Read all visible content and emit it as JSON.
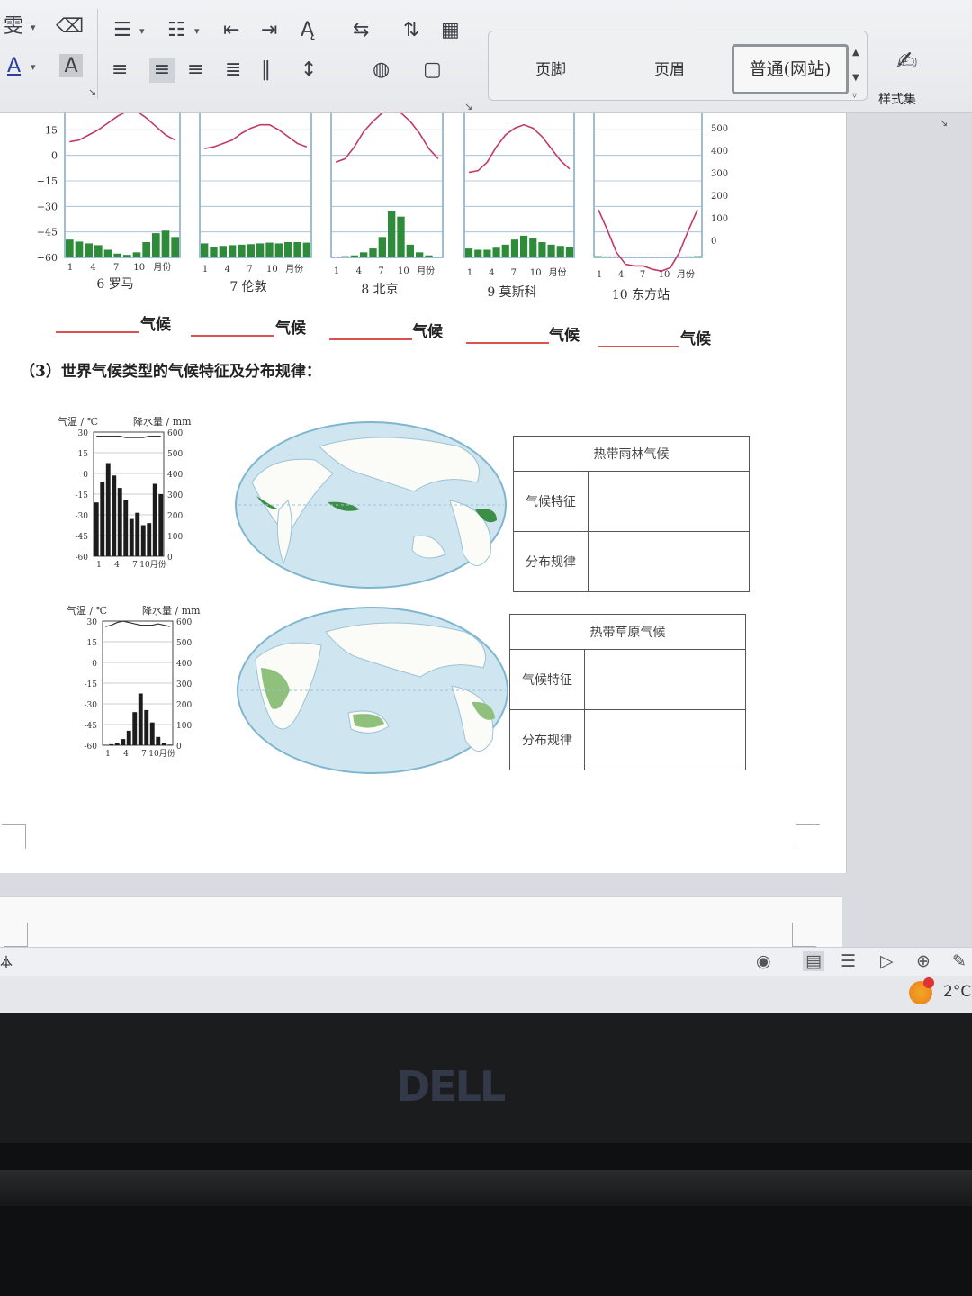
{
  "ribbon": {
    "left_partial_labels": [
      "雯",
      "A",
      "A"
    ],
    "style_items": [
      "页脚",
      "页眉",
      "普通(网站)"
    ],
    "styles_button_label": "样式集"
  },
  "charts_row": {
    "y_ticks_left": [
      "15",
      "0",
      "-15",
      "-30",
      "-45",
      "-60"
    ],
    "y_ticks_right": [
      "500",
      "400",
      "300",
      "200",
      "100",
      "0"
    ],
    "x_ticks": [
      "1",
      "4",
      "7",
      "10",
      "月份"
    ],
    "captions": [
      "6 罗马",
      "7 伦敦",
      "8 北京",
      "9 莫斯科",
      "10 东方站"
    ],
    "fill_suffix": "气候",
    "chart_data": [
      {
        "type": "bar+line",
        "title": "6 罗马",
        "precip": [
          70,
          62,
          55,
          48,
          30,
          15,
          10,
          20,
          60,
          95,
          105,
          80
        ],
        "temp": [
          8,
          9,
          12,
          15,
          19,
          23,
          26,
          26,
          22,
          17,
          12,
          9
        ]
      },
      {
        "type": "bar+line",
        "title": "7 伦敦",
        "precip": [
          55,
          40,
          45,
          48,
          50,
          52,
          55,
          58,
          55,
          60,
          60,
          58
        ],
        "temp": [
          4,
          5,
          7,
          9,
          13,
          16,
          18,
          18,
          15,
          11,
          7,
          5
        ]
      },
      {
        "type": "bar+line",
        "title": "8 北京",
        "precip": [
          3,
          5,
          8,
          20,
          35,
          80,
          180,
          160,
          50,
          20,
          8,
          3
        ],
        "temp": [
          -4,
          -2,
          5,
          14,
          20,
          25,
          26,
          25,
          20,
          13,
          4,
          -2
        ]
      },
      {
        "type": "bar+line",
        "title": "9 莫斯科",
        "precip": [
          35,
          30,
          30,
          38,
          50,
          70,
          85,
          75,
          60,
          50,
          45,
          40
        ],
        "temp": [
          -10,
          -9,
          -4,
          5,
          12,
          16,
          18,
          16,
          11,
          4,
          -3,
          -8
        ]
      },
      {
        "type": "bar+line",
        "title": "10 东方站",
        "precip": [
          5,
          4,
          4,
          3,
          3,
          3,
          3,
          3,
          3,
          3,
          4,
          5
        ],
        "temp": [
          -32,
          -44,
          -57,
          -64,
          -65,
          -65,
          -67,
          -68,
          -66,
          -57,
          -44,
          -32
        ]
      }
    ]
  },
  "question": {
    "text": "（3）世界气候类型的气候特征及分布规律："
  },
  "climographs": [
    {
      "temp_label": "气温 / ℃",
      "precip_label": "降水量 / mm",
      "y_ticks_left": [
        "30",
        "15",
        "0",
        "-15",
        "-30",
        "-45",
        "-60"
      ],
      "y_ticks_right": [
        "600",
        "500",
        "400",
        "300",
        "200",
        "100",
        "0"
      ],
      "x_ticks": [
        "1",
        "4",
        "7",
        "10月份"
      ],
      "chart_data": {
        "type": "bar+line",
        "precip": [
          260,
          360,
          450,
          390,
          330,
          270,
          180,
          210,
          150,
          160,
          350,
          300
        ],
        "temp": [
          27,
          27,
          27,
          27,
          27,
          26,
          26,
          26,
          26,
          27,
          27,
          27
        ]
      }
    },
    {
      "temp_label": "气温 / ℃",
      "precip_label": "降水量 / mm",
      "y_ticks_left": [
        "30",
        "15",
        "0",
        "-15",
        "-30",
        "-45",
        "-60"
      ],
      "y_ticks_right": [
        "600",
        "500",
        "400",
        "300",
        "200",
        "100",
        "0"
      ],
      "x_ticks": [
        "1",
        "4",
        "7",
        "10月份"
      ],
      "chart_data": {
        "type": "bar+line",
        "precip": [
          2,
          5,
          10,
          30,
          70,
          160,
          250,
          170,
          110,
          40,
          10,
          3
        ],
        "temp": [
          26,
          27,
          29,
          30,
          29,
          28,
          27,
          27,
          27,
          28,
          27,
          26
        ]
      }
    }
  ],
  "tables": [
    {
      "title": "热带雨林气候",
      "row1": "气候特征",
      "row2": "分布规律"
    },
    {
      "title": "热带草原气候",
      "row1": "气候特征",
      "row2": "分布规律"
    }
  ],
  "status": {
    "left_text": "本",
    "weather": "2°C"
  },
  "laptop": {
    "brand": "DELL"
  },
  "colors": {
    "bar_green": "#2e8b3a",
    "line_red": "#c0396a",
    "map_green": "#3d8f48",
    "map_water": "#cfe6f1"
  }
}
